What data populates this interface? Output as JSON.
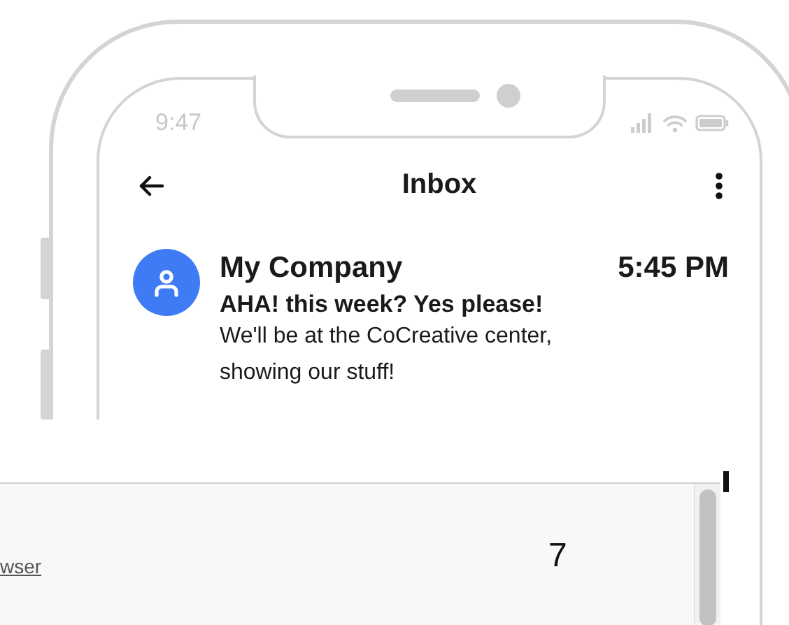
{
  "status_bar": {
    "time": "9:47"
  },
  "header": {
    "title": "Inbox"
  },
  "messages": [
    {
      "sender": "My Company",
      "time": "5:45 PM",
      "subject": "AHA! this week? Yes please!",
      "preview": "We'll be at the CoCreative center, showing our stuff!"
    }
  ],
  "overlay": {
    "link": "wser",
    "number": "7"
  }
}
